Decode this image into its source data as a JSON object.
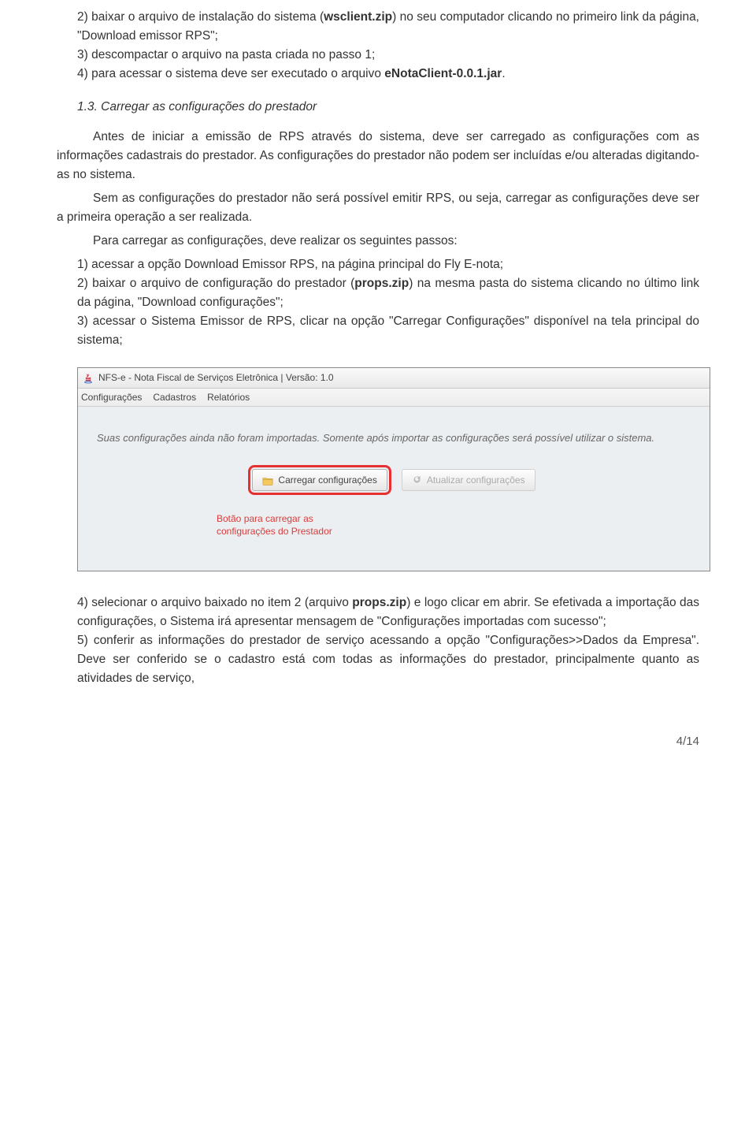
{
  "p1": {
    "item2_a": "2) baixar o arquivo de instalação do sistema (",
    "item2_b": "wsclient.zip",
    "item2_c": ") no seu computador clicando no primeiro link da página, \"Download emissor RPS\";",
    "item3": "3) descompactar o arquivo na pasta criada no passo 1;",
    "item4_a": "4) para acessar o sistema deve ser executado o arquivo ",
    "item4_b": "eNotaClient-0.0.1.jar",
    "item4_c": "."
  },
  "heading": "1.3. Carregar as configurações do prestador",
  "body": {
    "para1": "Antes de iniciar a emissão de RPS através do sistema, deve ser carregado as configurações com as informações cadastrais do prestador. As configurações do prestador não podem ser incluídas e/ou alteradas digitando-as no sistema.",
    "para2": "Sem as configurações do prestador não será possível emitir RPS, ou seja, carregar as configurações deve ser a primeira operação a ser realizada.",
    "para3": "Para carregar as configurações, deve realizar os seguintes passos:",
    "li1": "1) acessar a opção Download Emissor RPS, na página principal do Fly E-nota;",
    "li2_a": "2) baixar o arquivo de configuração do prestador (",
    "li2_b": "props.zip",
    "li2_c": ") na mesma pasta do sistema clicando no último link da página, \"Download configurações\";",
    "li3": "3) acessar o Sistema Emissor de RPS, clicar na opção \"Carregar Configurações\" disponível na tela principal do sistema;"
  },
  "app": {
    "title": "NFS-e - Nota Fiscal de Serviços Eletrônica | Versão: 1.0",
    "menu": {
      "m1": "Configurações",
      "m2": "Cadastros",
      "m3": "Relatórios"
    },
    "message": "Suas configurações ainda não foram importadas. Somente após importar as configurações será possível utilizar o sistema.",
    "btn_load": "Carregar configurações",
    "btn_update": "Atualizar configurações",
    "callout": "Botão para carregar as configurações do Prestador"
  },
  "after": {
    "li4_a": "4) selecionar o arquivo baixado no item 2 (arquivo ",
    "li4_b": "props.zip",
    "li4_c": ") e logo clicar em abrir. Se efetivada a importação das configurações, o Sistema irá apresentar mensagem de \"Configurações importadas com sucesso\";",
    "li5": "5) conferir as informações do prestador de serviço acessando a opção \"Configurações>>Dados da Empresa\". Deve ser conferido se o cadastro está com todas as informações do prestador, principalmente quanto as atividades de serviço,"
  },
  "footer": "4/14"
}
